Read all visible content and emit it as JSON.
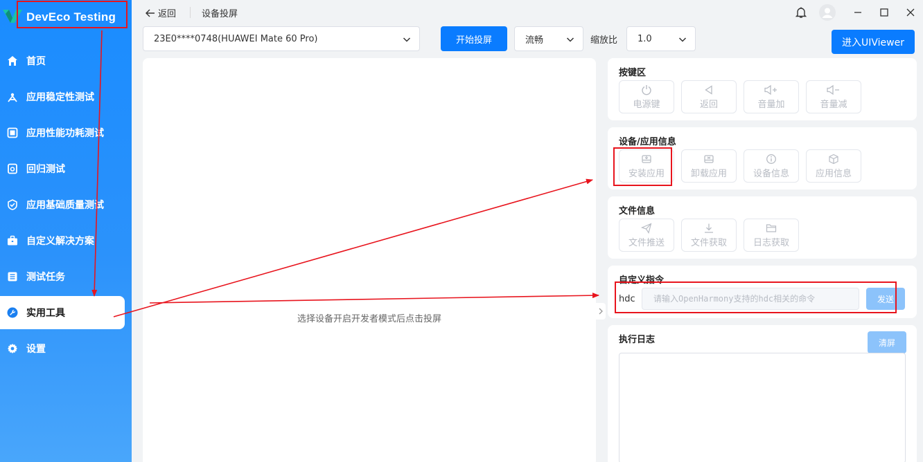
{
  "brand": {
    "name": "DevEco Testing"
  },
  "sidebar": {
    "items": [
      {
        "label": "首页",
        "icon": "home-icon"
      },
      {
        "label": "应用稳定性测试",
        "icon": "stability-icon"
      },
      {
        "label": "应用性能功耗测试",
        "icon": "performance-icon"
      },
      {
        "label": "回归测试",
        "icon": "regression-icon"
      },
      {
        "label": "应用基础质量测试",
        "icon": "quality-check-icon"
      },
      {
        "label": "自定义解决方案",
        "icon": "briefcase-icon"
      },
      {
        "label": "测试任务",
        "icon": "task-list-icon"
      },
      {
        "label": "实用工具",
        "icon": "wrench-icon",
        "active": true
      },
      {
        "label": "设置",
        "icon": "gear-icon"
      }
    ]
  },
  "header": {
    "back_label": "返回",
    "title": "设备投屏"
  },
  "toolbar": {
    "device_value": "23E0****0748(HUAWEI Mate 60 Pro)",
    "start_cast_label": "开始投屏",
    "quality_value": "流畅",
    "zoom_label": "缩放比",
    "zoom_value": "1.0",
    "uiviewer_label": "进入UIViewer"
  },
  "screen": {
    "hint": "选择设备开启开发者模式后点击投屏"
  },
  "keys_section": {
    "title": "按键区",
    "buttons": [
      {
        "label": "电源键",
        "icon": "power-icon"
      },
      {
        "label": "返回",
        "icon": "back-triangle-icon"
      },
      {
        "label": "音量加",
        "icon": "volume-up-icon"
      },
      {
        "label": "音量减",
        "icon": "volume-down-icon"
      }
    ]
  },
  "device_section": {
    "title": "设备/应用信息",
    "buttons": [
      {
        "label": "安装应用",
        "icon": "install-app-icon"
      },
      {
        "label": "卸载应用",
        "icon": "uninstall-app-icon"
      },
      {
        "label": "设备信息",
        "icon": "info-icon"
      },
      {
        "label": "应用信息",
        "icon": "cube-icon"
      }
    ]
  },
  "file_section": {
    "title": "文件信息",
    "buttons": [
      {
        "label": "文件推送",
        "icon": "send-icon"
      },
      {
        "label": "文件获取",
        "icon": "download-icon"
      },
      {
        "label": "日志获取",
        "icon": "folder-icon"
      }
    ]
  },
  "command_section": {
    "title": "自定义指令",
    "prefix": "hdc",
    "placeholder": "请输入OpenHarmony支持的hdc相关的命令",
    "send_label": "发送"
  },
  "log_section": {
    "title": "执行日志",
    "clear_label": "清屏"
  },
  "colors": {
    "accent": "#0a7cff",
    "annotation": "#e8141d",
    "sidebar": "#1a8cff"
  }
}
